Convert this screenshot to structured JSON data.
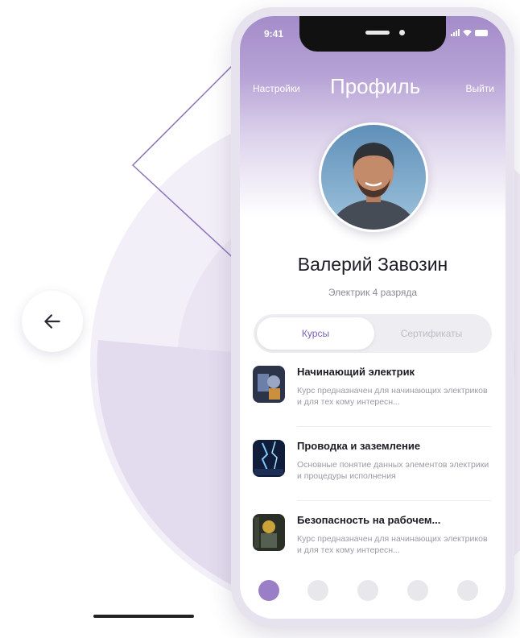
{
  "colors": {
    "accent": "#9a7fc6",
    "header_gradient_top": "#a48cc9",
    "decor": "#eae3f1"
  },
  "status_bar": {
    "time": "9:41"
  },
  "header": {
    "left_link": "Настройки",
    "title": "Профиль",
    "right_link": "Выйти"
  },
  "profile": {
    "name": "Валерий Завозин",
    "role": "Электрик 4 разряда"
  },
  "tabs": [
    {
      "label": "Курсы",
      "active": true
    },
    {
      "label": "Сертификаты",
      "active": false
    }
  ],
  "courses": [
    {
      "title": "Начинающий электрик",
      "description": "Курс предназначен для начинающих электриков и для тех кому интересн..."
    },
    {
      "title": "Проводка и заземление",
      "description": "Основные понятие данных элементов электрики и процедуры исполнения"
    },
    {
      "title": "Безопасность на рабочем...",
      "description": "Курс предназначен для начинающих электриков и для тех кому интересн..."
    }
  ],
  "icons": {
    "back": "arrow-left-icon"
  }
}
